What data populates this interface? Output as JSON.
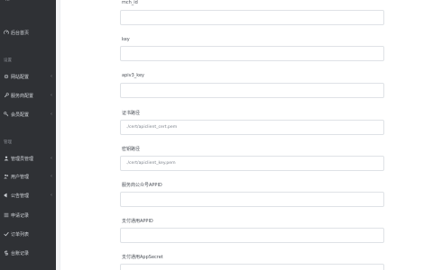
{
  "app": {
    "brand": "..."
  },
  "sidebar": {
    "items": [
      {
        "label": "后台首页",
        "icon": "dashboard-icon",
        "has_chevron": false
      },
      {
        "label": "网站配置",
        "icon": "settings-icon",
        "has_chevron": true
      },
      {
        "label": "服务商配置",
        "icon": "wrench-icon",
        "has_chevron": true
      },
      {
        "label": "会员配置",
        "icon": "key-icon",
        "has_chevron": true
      },
      {
        "label": "管理员管理",
        "icon": "user-icon",
        "has_chevron": true
      },
      {
        "label": "用户管理",
        "icon": "users-icon",
        "has_chevron": true
      },
      {
        "label": "公告管理",
        "icon": "bullhorn-icon",
        "has_chevron": true
      },
      {
        "label": "申请记录",
        "icon": "list-icon",
        "has_chevron": false
      },
      {
        "label": "订单列表",
        "icon": "check-icon",
        "has_chevron": false
      },
      {
        "label": "台账记录",
        "icon": "dollar-icon",
        "has_chevron": false
      }
    ],
    "sections": [
      "设置",
      "管理"
    ]
  },
  "form": {
    "fields": [
      {
        "label": "mch_id",
        "value": ""
      },
      {
        "label": "key",
        "value": ""
      },
      {
        "label": "apiv3_key",
        "value": ""
      },
      {
        "label": "证书路径",
        "value": "./cert/apiclient_cert.pem"
      },
      {
        "label": "密钥路径",
        "value": "./cert/apiclient_key.pem"
      },
      {
        "label": "服务商公众号APPID",
        "value": ""
      },
      {
        "label": "支付通用APPID",
        "value": ""
      },
      {
        "label": "支付通用AppSecret",
        "value": ""
      }
    ]
  },
  "colors": {
    "sidebar_bg": "#2f3135",
    "sidebar_text": "#d3d6db",
    "card_bg": "#ffffff",
    "input_border": "#dfe2e6"
  }
}
